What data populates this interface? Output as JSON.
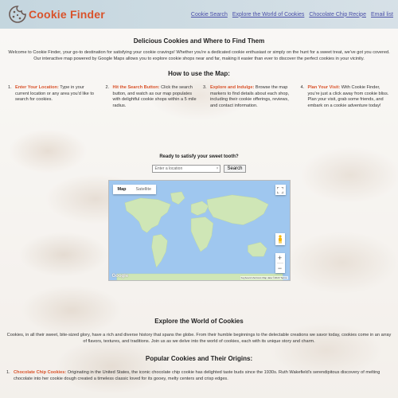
{
  "header": {
    "brand": "Cookie Finder",
    "nav": [
      "Cookie Search",
      "Explore the World of Cookies",
      "Chocolate Chip Recipe",
      "Email list"
    ]
  },
  "hero": {
    "title": "Delicious Cookies and Where to Find Them",
    "intro": "Welcome to Cookie Finder, your go-to destination for satisfying your cookie cravings! Whether you're a dedicated cookie enthusiast or simply on the hunt for a sweet treat, we've got you covered. Our interactive map powered by Google Maps allows you to explore cookie shops near and far, making it easier than ever to discover the perfect cookies in your vicinity."
  },
  "howto": {
    "title": "How to use the Map:",
    "steps": [
      {
        "num": "1.",
        "label": "Enter Your Location:",
        "text": " Type in your current location or any area you'd like to search for cookies."
      },
      {
        "num": "2.",
        "label": "Hit the Search Button:",
        "text": " Click the search button, and watch as our map populates with delightful cookie shops within a 5 mile radius."
      },
      {
        "num": "3.",
        "label": "Explore and Indulge:",
        "text": " Browse the map markers to find details about each shop, including their cookie offerings, reviews, and contact information."
      },
      {
        "num": "4.",
        "label": "Plan Your Visit:",
        "text": " With Cookie Finder, you're just a click away from cookie bliss. Plan your visit, grab some friends, and embark on a cookie adventure today!"
      }
    ]
  },
  "search": {
    "prompt": "Ready to satisfy your sweet tooth?",
    "placeholder": "Enter a location",
    "clear_glyph": "×",
    "button": "Search"
  },
  "map": {
    "type_map": "Map",
    "type_satellite": "Satellite",
    "zoom_in": "+",
    "zoom_out": "−",
    "logo": "Google",
    "attribution": "Keyboard shortcuts   Map data ©2023   Terms",
    "water_color": "#9fc7ef",
    "land_color": "#cfe6b6"
  },
  "explore": {
    "title": "Explore the World of Cookies",
    "text": "Cookies, in all their sweet, bite-sized glory, have a rich and diverse history that spans the globe. From their humble beginnings to the delectable creations we savor today, cookies come in an array of flavors, textures, and traditions. Join us as we delve into the world of cookies, each with its unique story and charm."
  },
  "popular": {
    "title": "Popular Cookies and Their Origins:",
    "items": [
      {
        "num": "1.",
        "label": "Chocolate Chip Cookies:",
        "text": " Originating in the United States, the iconic chocolate chip cookie has delighted taste buds since the 1930s. Ruth Wakefield's serendipitous discovery of melting chocolate into her cookie dough created a timeless classic loved for its gooey, melty centers and crisp edges."
      }
    ]
  },
  "colors": {
    "accent": "#d9532b",
    "nav_link": "#4a4fa8"
  }
}
